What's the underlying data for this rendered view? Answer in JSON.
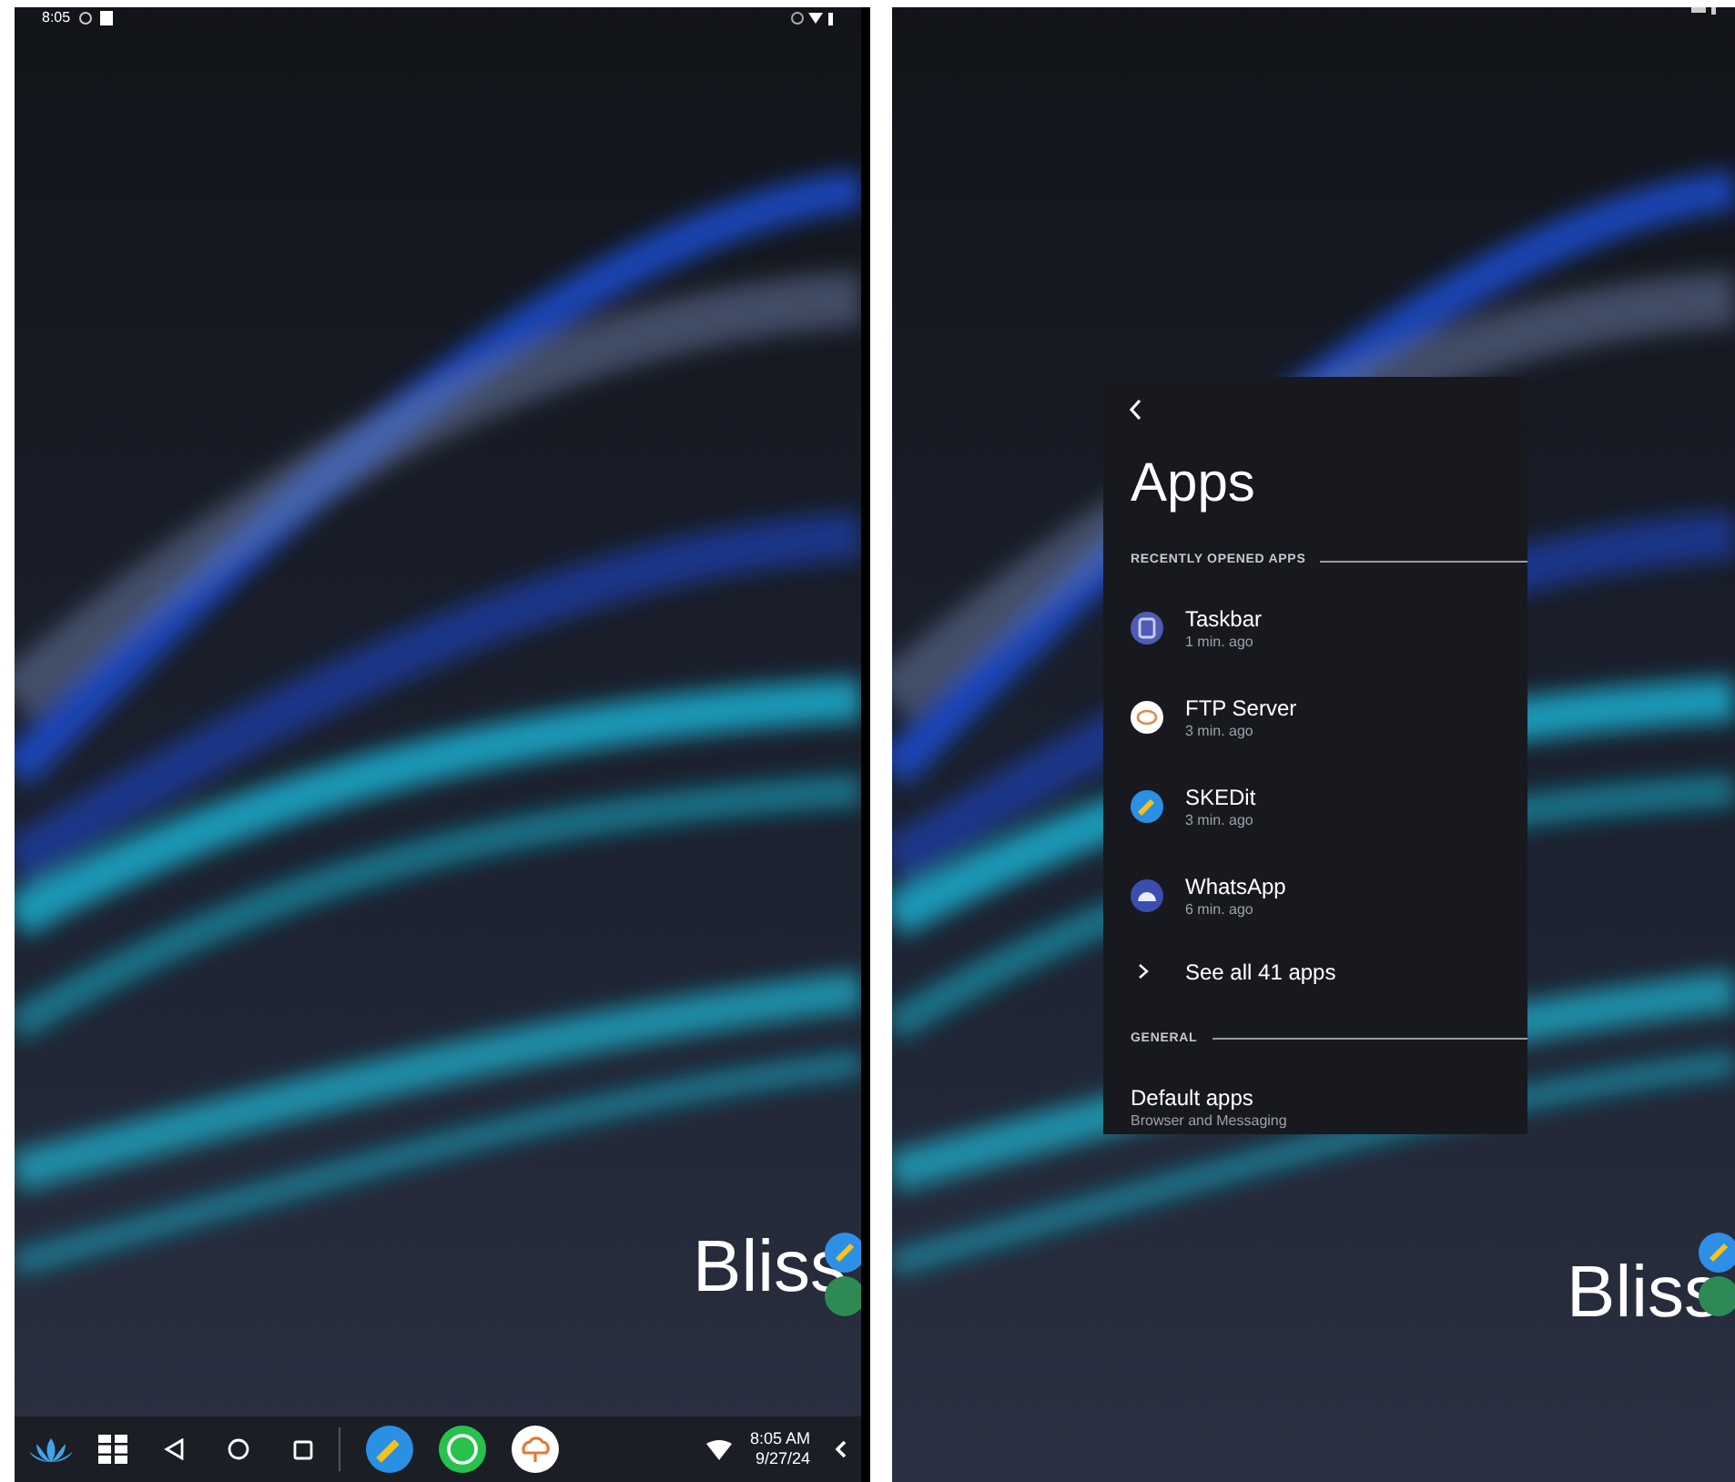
{
  "left_screen": {
    "status_bar": {
      "time": "8:05"
    },
    "home_label": "Bliss",
    "taskbar": {
      "time": "8:05 AM",
      "date": "9/27/24"
    }
  },
  "right_screen": {
    "home_label": "Bliss",
    "settings_window": {
      "title": "Apps",
      "sections": [
        {
          "heading": "RECENTLY OPENED APPS",
          "items": [
            {
              "kind": "app",
              "name": "Taskbar",
              "time": "1 min. ago"
            },
            {
              "kind": "app",
              "name": "FTP Server",
              "time": "3 min. ago"
            },
            {
              "kind": "app",
              "name": "SKEDit",
              "time": "3 min. ago"
            },
            {
              "kind": "app",
              "name": "WhatsApp",
              "time": "6 min. ago"
            },
            {
              "kind": "link",
              "name": "See all 41 apps"
            }
          ]
        },
        {
          "heading": "GENERAL",
          "items": [
            {
              "kind": "setting",
              "name": "Default apps",
              "time": "Browser and Messaging"
            }
          ]
        }
      ]
    }
  }
}
